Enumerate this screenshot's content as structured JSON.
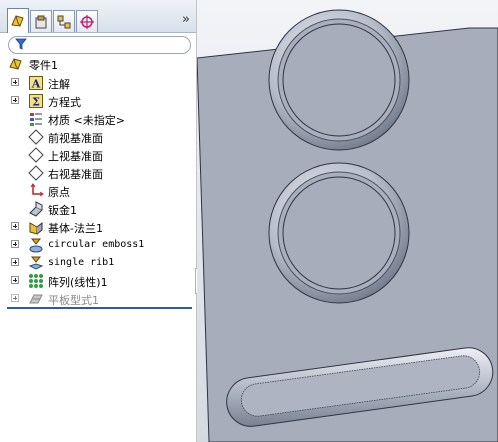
{
  "tree": {
    "root_label": "零件1",
    "items": [
      {
        "label": "注解"
      },
      {
        "label": "方程式"
      },
      {
        "label": "材质 <未指定>"
      },
      {
        "label": "前视基准面"
      },
      {
        "label": "上视基准面"
      },
      {
        "label": "右视基准面"
      },
      {
        "label": "原点"
      },
      {
        "label": "钣金1"
      },
      {
        "label": "基体-法兰1"
      },
      {
        "label": "circular emboss1"
      },
      {
        "label": "single rib1"
      },
      {
        "label": "阵列(线性)1"
      },
      {
        "label": "平板型式1"
      }
    ]
  },
  "toolbar": {
    "more_label": "»"
  },
  "colors": {
    "part_face": "#a7adba",
    "part_edge": "#2f3440",
    "tree_separator": "#2d5aa8"
  },
  "icons": [
    "feature-manager-icon",
    "property-manager-icon",
    "configuration-manager-icon",
    "dimxpert-icon",
    "filter-icon"
  ]
}
